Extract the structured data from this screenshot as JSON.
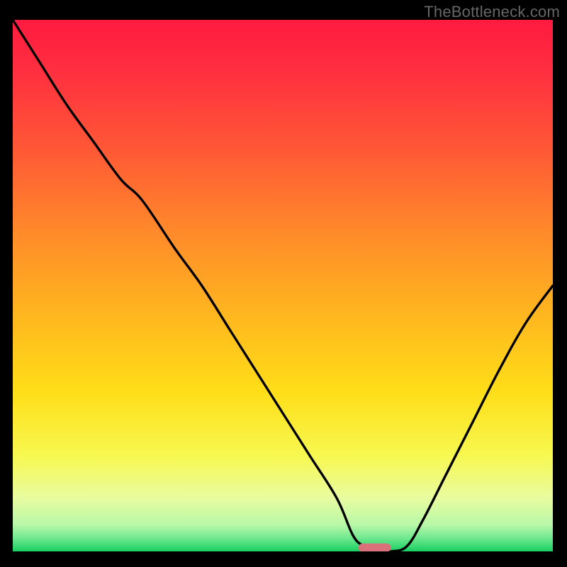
{
  "watermark": "TheBottleneck.com",
  "chart_data": {
    "type": "line",
    "title": "",
    "xlabel": "",
    "ylabel": "",
    "xlim": [
      0,
      100
    ],
    "ylim": [
      0,
      100
    ],
    "series": [
      {
        "name": "bottleneck-curve",
        "x": [
          0,
          5,
          10,
          15,
          20,
          24,
          30,
          35,
          40,
          45,
          50,
          55,
          60,
          63,
          65,
          67,
          70,
          73,
          76,
          80,
          85,
          90,
          95,
          100
        ],
        "y": [
          100,
          92,
          84,
          77,
          70,
          66,
          57,
          50,
          42,
          34,
          26,
          18,
          10,
          3,
          1,
          0,
          0,
          1,
          6,
          14,
          24,
          34,
          43,
          50
        ]
      }
    ],
    "optimum_marker": {
      "x_start": 64,
      "x_end": 70,
      "y": 0.7
    },
    "gradient_stops": [
      {
        "offset": 0.0,
        "color": "#ff1a40"
      },
      {
        "offset": 0.1,
        "color": "#ff3040"
      },
      {
        "offset": 0.25,
        "color": "#ff5a35"
      },
      {
        "offset": 0.4,
        "color": "#ff8a2a"
      },
      {
        "offset": 0.55,
        "color": "#ffb51f"
      },
      {
        "offset": 0.7,
        "color": "#ffde18"
      },
      {
        "offset": 0.82,
        "color": "#f7f850"
      },
      {
        "offset": 0.9,
        "color": "#e8fca0"
      },
      {
        "offset": 0.95,
        "color": "#b8f8a8"
      },
      {
        "offset": 0.975,
        "color": "#70e890"
      },
      {
        "offset": 1.0,
        "color": "#18d060"
      }
    ]
  }
}
